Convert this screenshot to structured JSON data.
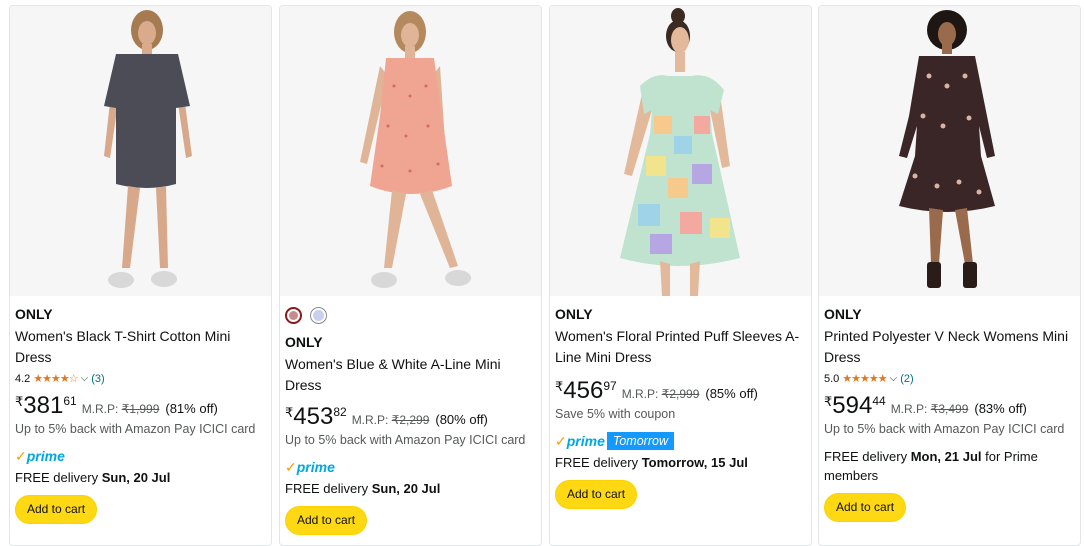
{
  "colors": {
    "star": "#de7921",
    "prime_check": "#ff9900",
    "prime_word": "#00a8e1",
    "prime_badge": "#1399ff",
    "button": "#ffd814",
    "muted": "#565959",
    "link": "#007185"
  },
  "products": [
    {
      "brand": "ONLY",
      "title": "Women's Black T-Shirt Cotton Mini Dress",
      "rating_value": "4.2",
      "stars": "★★★★☆",
      "review_count": "(3)",
      "currency": "₹",
      "price_whole": "381",
      "price_fraction": "61",
      "mrp_label": "M.R.P:",
      "mrp_value": "₹1,999",
      "discount": "(81% off)",
      "offer": "Up to 5% back with Amazon Pay ICICI card",
      "prime_check": "✓",
      "prime_word": "prime",
      "delivery_prefix": "FREE delivery",
      "delivery_date": "Sun, 20 Jul",
      "delivery_suffix": "",
      "button": "Add to cart",
      "image_icon": "dress-photo-icon"
    },
    {
      "brand": "ONLY",
      "title": "Women's Blue & White A-Line Mini Dress",
      "swatches": [
        "#c98a8a",
        "#c8d0ee"
      ],
      "currency": "₹",
      "price_whole": "453",
      "price_fraction": "82",
      "mrp_label": "M.R.P:",
      "mrp_value": "₹2,299",
      "discount": "(80% off)",
      "offer": "Up to 5% back with Amazon Pay ICICI card",
      "prime_check": "✓",
      "prime_word": "prime",
      "delivery_prefix": "FREE delivery",
      "delivery_date": "Sun, 20 Jul",
      "delivery_suffix": "",
      "button": "Add to cart",
      "image_icon": "dress-photo-icon"
    },
    {
      "brand": "ONLY",
      "title": "Women's Floral Printed Puff Sleeves A-Line Mini Dress",
      "currency": "₹",
      "price_whole": "456",
      "price_fraction": "97",
      "mrp_label": "M.R.P:",
      "mrp_value": "₹2,999",
      "discount": "(85% off)",
      "offer": "Save 5% with coupon",
      "prime_check": "✓",
      "prime_word": "prime",
      "prime_badge": "Tomorrow",
      "delivery_prefix": "FREE delivery",
      "delivery_date": "Tomorrow, 15 Jul",
      "delivery_suffix": "",
      "button": "Add to cart",
      "image_icon": "dress-photo-icon"
    },
    {
      "brand": "ONLY",
      "title": "Printed Polyester V Neck Womens Mini Dress",
      "rating_value": "5.0",
      "stars": "★★★★★",
      "review_count": "(2)",
      "currency": "₹",
      "price_whole": "594",
      "price_fraction": "44",
      "mrp_label": "M.R.P:",
      "mrp_value": "₹3,499",
      "discount": "(83% off)",
      "offer": "Up to 5% back with Amazon Pay ICICI card",
      "delivery_prefix": "FREE delivery",
      "delivery_date": "Mon, 21 Jul",
      "delivery_suffix": "for Prime members",
      "button": "Add to cart",
      "image_icon": "dress-photo-icon"
    }
  ]
}
